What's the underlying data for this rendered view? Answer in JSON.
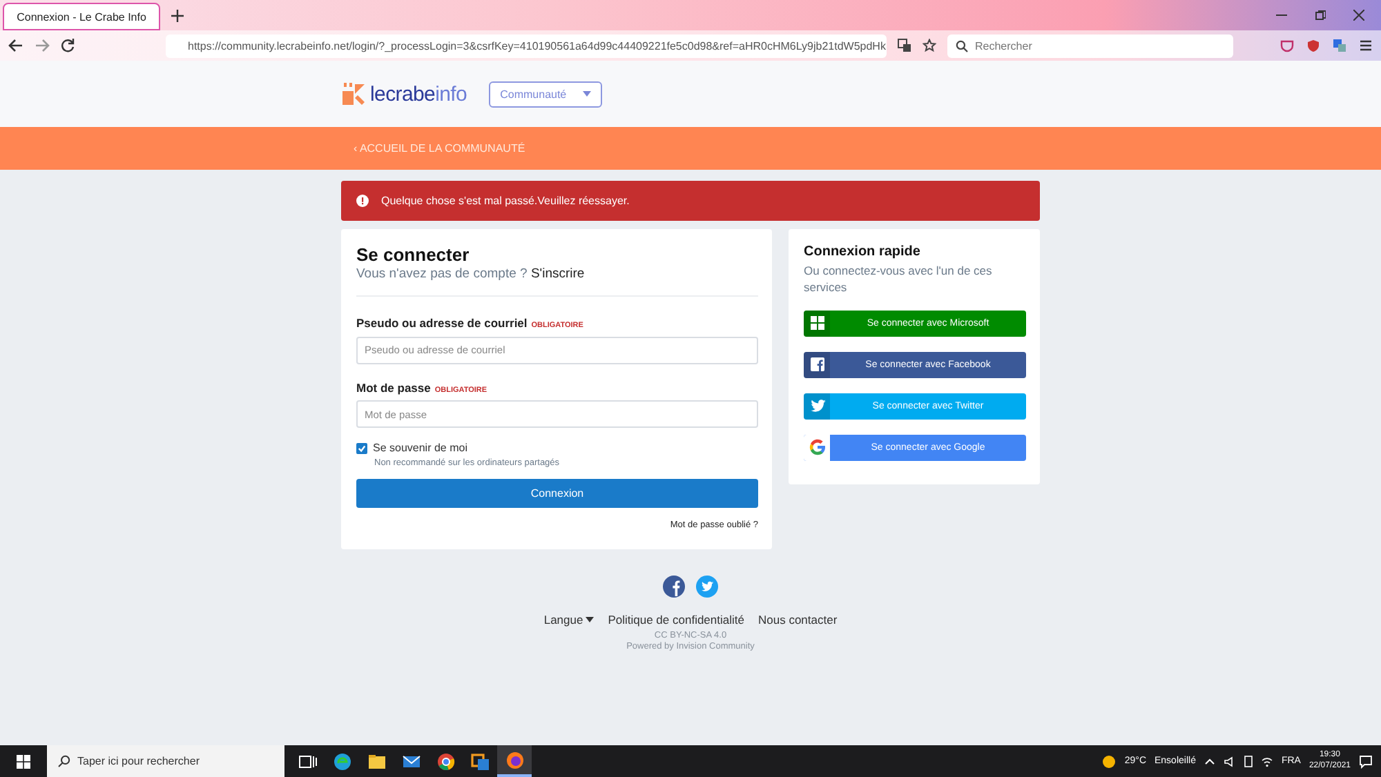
{
  "browser": {
    "tab_title": "Connexion - Le Crabe Info",
    "url": "https://community.lecrabeinfo.net/login/?_processLogin=3&csrfKey=410190561a64d99c44409221fe5c0d98&ref=aHR0cHM6Ly9jb21tdW5pdHk",
    "search_placeholder": "Rechercher"
  },
  "site_header": {
    "logo_main": "lecrabe",
    "logo_accent": "info",
    "community_select": "Communauté",
    "breadcrumb": "‹ ACCUEIL DE LA COMMUNAUTÉ"
  },
  "alert": {
    "message": "Quelque chose s'est mal passé.Veuillez réessayer."
  },
  "login": {
    "title": "Se connecter",
    "subtitle": "Vous n'avez pas de compte ?",
    "signup_link": "S'inscrire",
    "fields": [
      {
        "label": "Pseudo ou adresse de courriel",
        "required_tag": "OBLIGATOIRE",
        "placeholder": "Pseudo ou adresse de courriel"
      },
      {
        "label": "Mot de passe",
        "required_tag": "OBLIGATOIRE",
        "placeholder": "Mot de passe"
      }
    ],
    "remember": {
      "label": "Se souvenir de moi",
      "checked": true,
      "note": "Non recommandé sur les ordinateurs partagés"
    },
    "submit": "Connexion",
    "forgot_link": "Mot de passe oublié ?"
  },
  "quick_login": {
    "title": "Connexion rapide",
    "subtitle": "Ou connectez-vous avec l'un de ces services",
    "providers": [
      {
        "kind": "microsoft",
        "label": "Se connecter avec Microsoft",
        "color": "#008b00"
      },
      {
        "kind": "facebook",
        "label": "Se connecter avec Facebook",
        "color": "#3b5998"
      },
      {
        "kind": "twitter",
        "label": "Se connecter avec Twitter",
        "color": "#00abf0"
      },
      {
        "kind": "google",
        "label": "Se connecter avec Google",
        "color": "#4285f4"
      }
    ]
  },
  "footer": {
    "social": [
      {
        "kind": "facebook"
      },
      {
        "kind": "twitter"
      }
    ],
    "links": [
      {
        "label": "Langue",
        "kind": "dropdown"
      },
      {
        "label": "Politique de confidentialité",
        "kind": "link"
      },
      {
        "label": "Nous contacter",
        "kind": "link"
      }
    ],
    "license": "CC BY-NC-SA 4.0",
    "powered_by": "Powered by Invision Community"
  },
  "taskbar": {
    "search_placeholder": "Taper ici pour rechercher",
    "apps": [
      {
        "kind": "taskview",
        "selected": false
      },
      {
        "kind": "edge",
        "selected": false
      },
      {
        "kind": "explorer",
        "selected": false
      },
      {
        "kind": "mail",
        "selected": false
      },
      {
        "kind": "chrome",
        "selected": false
      },
      {
        "kind": "office",
        "selected": false
      },
      {
        "kind": "firefox",
        "selected": true
      }
    ],
    "weather_temp": "29°C",
    "weather_text": "Ensoleillé",
    "language": "FRA",
    "time": "19:30",
    "date": "22/07/2021"
  }
}
